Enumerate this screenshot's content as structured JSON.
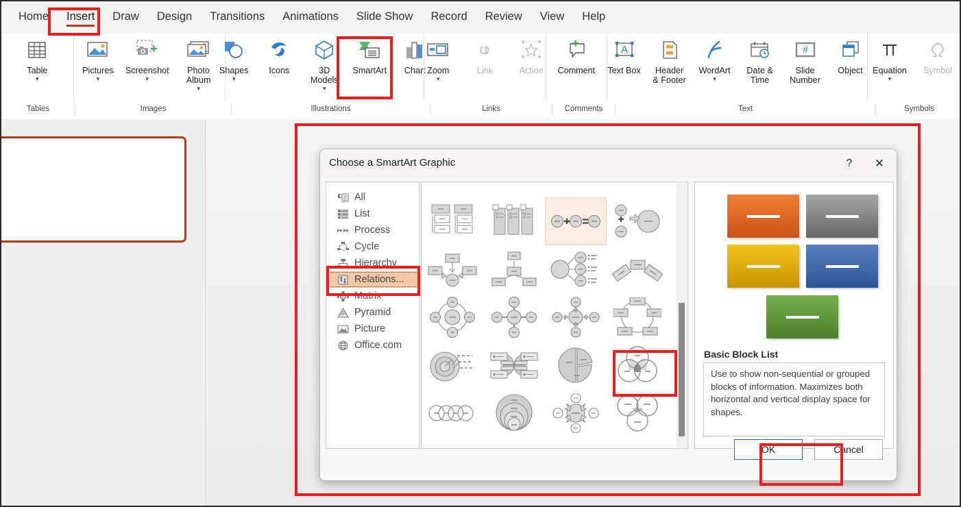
{
  "ribbon": {
    "tabs": [
      {
        "label": "Home",
        "active": false
      },
      {
        "label": "Insert",
        "active": true
      },
      {
        "label": "Draw",
        "active": false
      },
      {
        "label": "Design",
        "active": false
      },
      {
        "label": "Transitions",
        "active": false
      },
      {
        "label": "Animations",
        "active": false
      },
      {
        "label": "Slide Show",
        "active": false
      },
      {
        "label": "Record",
        "active": false
      },
      {
        "label": "Review",
        "active": false
      },
      {
        "label": "View",
        "active": false
      },
      {
        "label": "Help",
        "active": false
      }
    ],
    "groups": [
      {
        "label": "Tables",
        "items": [
          {
            "label": "Table",
            "icon": "table-icon",
            "dropdown": true
          }
        ]
      },
      {
        "label": "Images",
        "items": [
          {
            "label": "Pictures",
            "icon": "pictures-icon",
            "dropdown": true
          },
          {
            "label": "Screenshot",
            "icon": "screenshot-icon",
            "dropdown": true
          },
          {
            "label": "Photo Album",
            "icon": "photo-album-icon",
            "dropdown": true
          }
        ]
      },
      {
        "label": "Illustrations",
        "items": [
          {
            "label": "Shapes",
            "icon": "shapes-icon",
            "dropdown": true
          },
          {
            "label": "Icons",
            "icon": "icons-icon",
            "dropdown": false
          },
          {
            "label": "3D Models",
            "icon": "3d-models-icon",
            "dropdown": true
          },
          {
            "label": "SmartArt",
            "icon": "smartart-icon",
            "dropdown": false
          },
          {
            "label": "Chart",
            "icon": "chart-icon",
            "dropdown": false
          }
        ]
      },
      {
        "label": "Links",
        "items": [
          {
            "label": "Zoom",
            "icon": "zoom-icon",
            "dropdown": true
          },
          {
            "label": "Link",
            "icon": "link-icon",
            "dropdown": false,
            "disabled": true
          },
          {
            "label": "Action",
            "icon": "action-icon",
            "dropdown": false,
            "disabled": true
          }
        ]
      },
      {
        "label": "Comments",
        "items": [
          {
            "label": "Comment",
            "icon": "comment-icon",
            "dropdown": false
          }
        ]
      },
      {
        "label": "Text",
        "items": [
          {
            "label": "Text Box",
            "icon": "text-box-icon",
            "dropdown": false
          },
          {
            "label": "Header & Footer",
            "icon": "header-footer-icon",
            "dropdown": false
          },
          {
            "label": "WordArt",
            "icon": "wordart-icon",
            "dropdown": true
          },
          {
            "label": "Date & Time",
            "icon": "date-time-icon",
            "dropdown": false
          },
          {
            "label": "Slide Number",
            "icon": "slide-number-icon",
            "dropdown": false
          },
          {
            "label": "Object",
            "icon": "object-icon",
            "dropdown": false
          }
        ]
      },
      {
        "label": "Symbols",
        "items": [
          {
            "label": "Equation",
            "icon": "equation-icon",
            "dropdown": true
          },
          {
            "label": "Symbol",
            "icon": "symbol-icon",
            "dropdown": false,
            "disabled": true
          }
        ]
      }
    ]
  },
  "dialog": {
    "title": "Choose a SmartArt Graphic",
    "help_glyph": "?",
    "close_glyph": "✕",
    "categories": [
      {
        "label": "All",
        "icon": "all-icon",
        "selected": false
      },
      {
        "label": "List",
        "icon": "list-icon",
        "selected": false
      },
      {
        "label": "Process",
        "icon": "process-icon",
        "selected": false
      },
      {
        "label": "Cycle",
        "icon": "cycle-icon",
        "selected": false
      },
      {
        "label": "Hierarchy",
        "icon": "hierarchy-icon",
        "selected": false
      },
      {
        "label": "Relations...",
        "icon": "relationship-icon",
        "selected": true
      },
      {
        "label": "Matrix",
        "icon": "matrix-icon",
        "selected": false
      },
      {
        "label": "Pyramid",
        "icon": "pyramid-icon",
        "selected": false
      },
      {
        "label": "Picture",
        "icon": "picture-icon",
        "selected": false
      },
      {
        "label": "Office.com",
        "icon": "office-com-icon",
        "selected": false
      }
    ],
    "preview": {
      "name": "Basic Block List",
      "description": "Use to show non-sequential or grouped blocks of information. Maximizes both horizontal and vertical display space for shapes.",
      "blocks": [
        {
          "color_top": "#ef7f33",
          "color_bottom": "#c9541a"
        },
        {
          "color_top": "#a6a6a6",
          "color_bottom": "#666666"
        },
        {
          "color_top": "#f4c21a",
          "color_bottom": "#c99500"
        },
        {
          "color_top": "#5581c2",
          "color_bottom": "#2d5496"
        },
        {
          "color_top": "#78ad4e",
          "color_bottom": "#4f7f2b"
        }
      ]
    },
    "buttons": {
      "ok": "OK",
      "cancel": "Cancel"
    }
  },
  "highlight_color": "#ee1c1c",
  "accent_color": "#b33d12",
  "selection_color": "#f5c6a8"
}
